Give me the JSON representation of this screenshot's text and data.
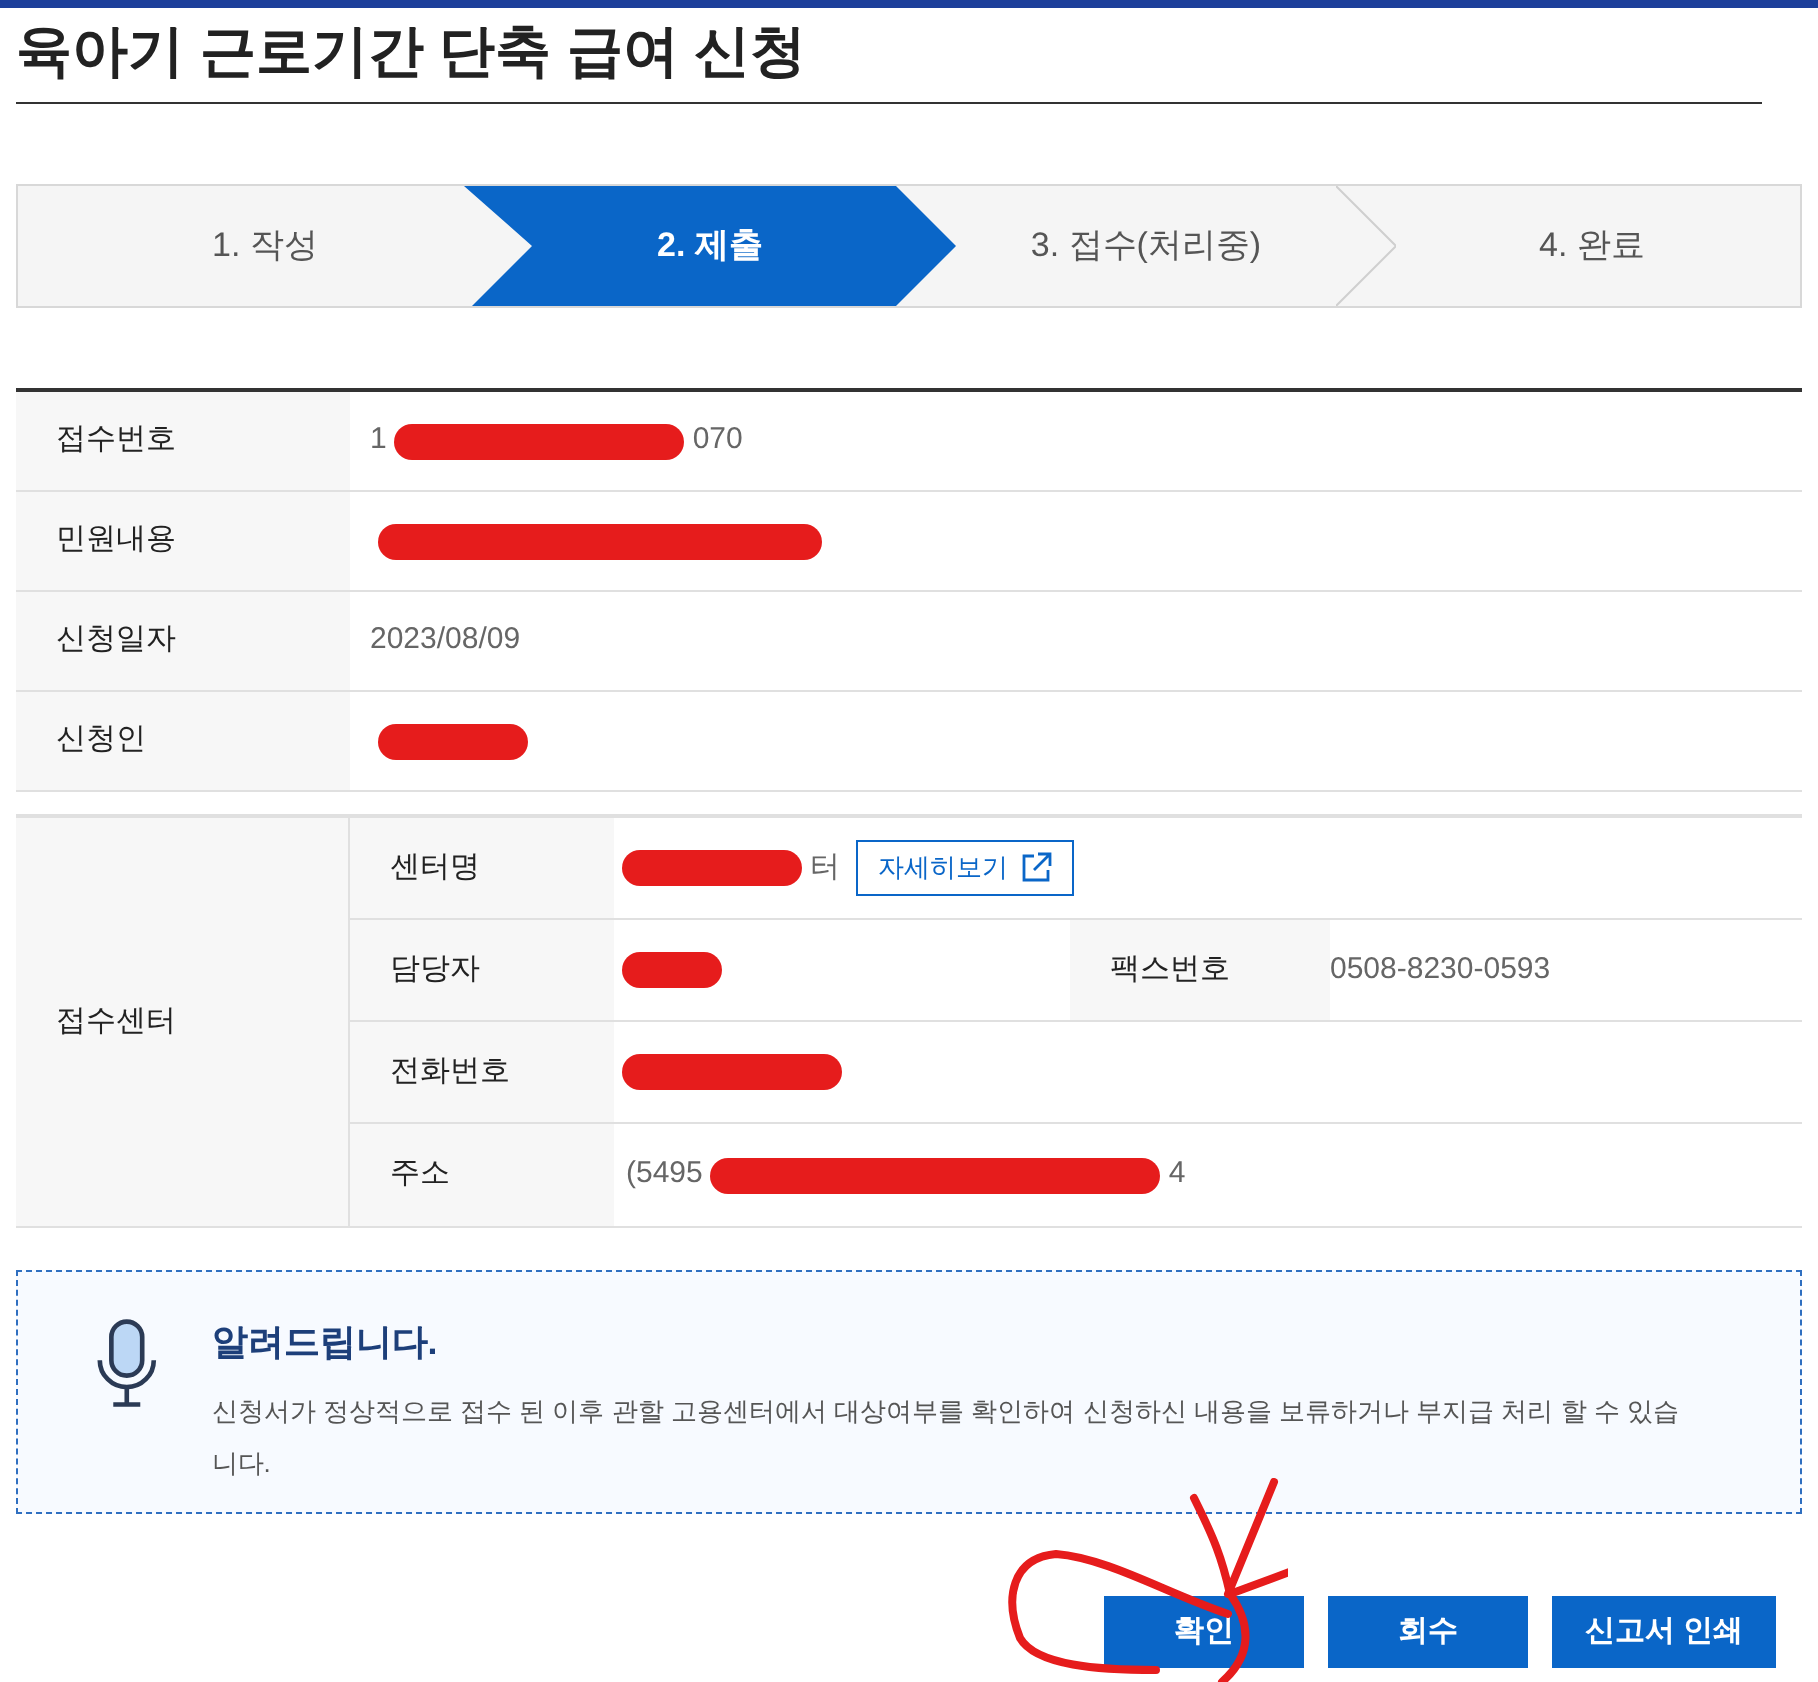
{
  "title": "육아기 근로기간 단축 급여 신청",
  "steps": [
    {
      "label": "1. 작성",
      "selected": false
    },
    {
      "label": "2. 제출",
      "selected": true
    },
    {
      "label": "3. 접수(처리중)",
      "selected": false
    },
    {
      "label": "4. 완료",
      "selected": false
    }
  ],
  "summary": [
    {
      "label": "접수번호",
      "before": "1",
      "after": "070",
      "redacted": true
    },
    {
      "label": "민원내용",
      "redacted": true
    },
    {
      "label": "신청일자",
      "before": "2023/08/09"
    },
    {
      "label": "신청인",
      "redacted": true
    }
  ],
  "center": {
    "label": "접수센터",
    "name": {
      "label": "센터명",
      "after": "터",
      "redacted": true,
      "link": "자세히보기"
    },
    "manager": {
      "label": "담당자",
      "redacted": true
    },
    "fax": {
      "label": "팩스번호",
      "value": "0508-8230-0593"
    },
    "phone": {
      "label": "전화번호",
      "redacted": true
    },
    "address": {
      "label": "주소",
      "before": "(5495",
      "after": "4",
      "redacted": true
    }
  },
  "notice": {
    "title": "알려드립니다.",
    "text": "신청서가 정상적으로 접수 된 이후 관할 고용센터에서 대상여부를 확인하여 신청하신 내용을 보류하거나 부지급 처리 할 수 있습니다."
  },
  "buttons": [
    "확인",
    "회수",
    "신고서 인쇄"
  ]
}
